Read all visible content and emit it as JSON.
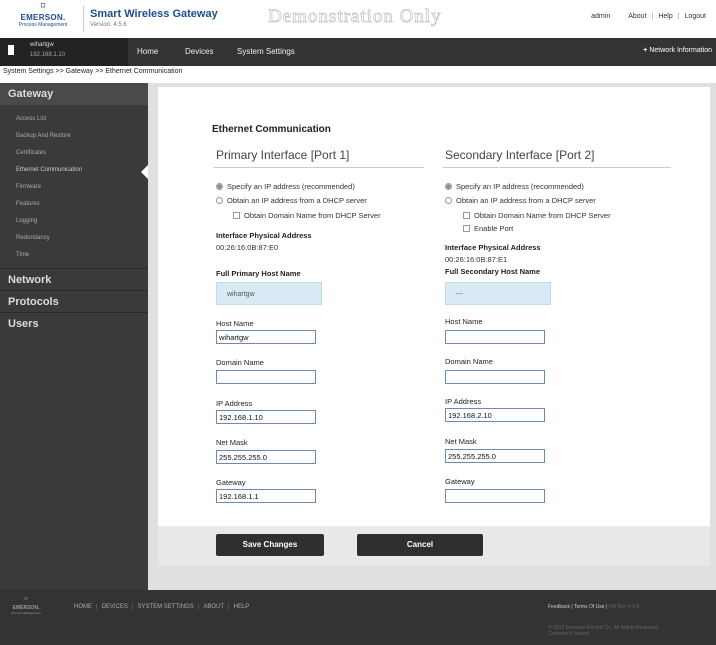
{
  "header": {
    "logo_text": "EMERSON.",
    "logo_sub": "Process Management",
    "app_title": "Smart Wireless Gateway",
    "version": "Version: 4.5.6",
    "watermark": "Demonstration Only",
    "user": "admin",
    "links": [
      "About",
      "Help",
      "Logout"
    ]
  },
  "nav": {
    "device_name": "wihartgw",
    "device_ip": "192.168.1.10",
    "items": [
      "Home",
      "Devices",
      "System Settings"
    ],
    "network_info": "Network Information"
  },
  "breadcrumb": "System Settings >> Gateway >> Ethernet Communication",
  "sidebar": {
    "sections": [
      {
        "label": "Gateway",
        "items": [
          "Access List",
          "Backup And Restore",
          "Certificates",
          "Ethernet Communication",
          "Firmware",
          "Features",
          "Logging",
          "Redundancy",
          "Time"
        ]
      },
      {
        "label": "Network"
      },
      {
        "label": "Protocols"
      },
      {
        "label": "Users"
      }
    ]
  },
  "form": {
    "title": "Ethernet Communication",
    "primary": {
      "heading": "Primary Interface [Port 1]",
      "opt_static": "Specify an IP address (recommended)",
      "opt_dhcp": "Obtain an IP address from a DHCP server",
      "opt_domain": "Obtain Domain Name from DHCP Server",
      "mac_label": "Interface Physical Address",
      "mac": "00:26:16:0B:87:E0",
      "full_host_label": "Full Primary Host Name",
      "full_host": "wihartgw",
      "host_label": "Host Name",
      "host": "wihartgw",
      "domain_label": "Domain Name",
      "domain": "",
      "ip_label": "IP Address",
      "ip": "192.168.1.10",
      "mask_label": "Net Mask",
      "mask": "255.255.255.0",
      "gw_label": "Gateway",
      "gw": "192.168.1.1"
    },
    "secondary": {
      "heading": "Secondary Interface [Port 2]",
      "opt_static": "Specify an IP address (recommended)",
      "opt_dhcp": "Obtain an IP address from a DHCP server",
      "opt_domain": "Obtain Domain Name from DHCP Server",
      "opt_enable": "Enable Port",
      "mac_label": "Interface Physical Address",
      "mac": "00:26:16:0B:87:E1",
      "full_host_label": "Full Secondary Host Name",
      "full_host": "---",
      "host_label": "Host Name",
      "host": "",
      "domain_label": "Domain Name",
      "domain": "",
      "ip_label": "IP Address",
      "ip": "192.168.2.10",
      "mask_label": "Net Mask",
      "mask": "255.255.255.0",
      "gw_label": "Gateway",
      "gw": ""
    },
    "save_label": "Save Changes",
    "cancel_label": "Cancel"
  },
  "footer": {
    "logo_text": "EMERSON.",
    "logo_sub": "Process Management",
    "links": [
      "HOME",
      "DEVICES",
      "SYSTEM SETTINGS",
      "ABOUT",
      "HELP"
    ],
    "feedback": "Feedback",
    "terms": "Terms Of Use",
    "ver": "FW Rev 4.5.6",
    "copyright_1": "© 2013 Emerson Electric Co. All Rights Reserved.",
    "copyright_2": "Consider It Solved."
  }
}
